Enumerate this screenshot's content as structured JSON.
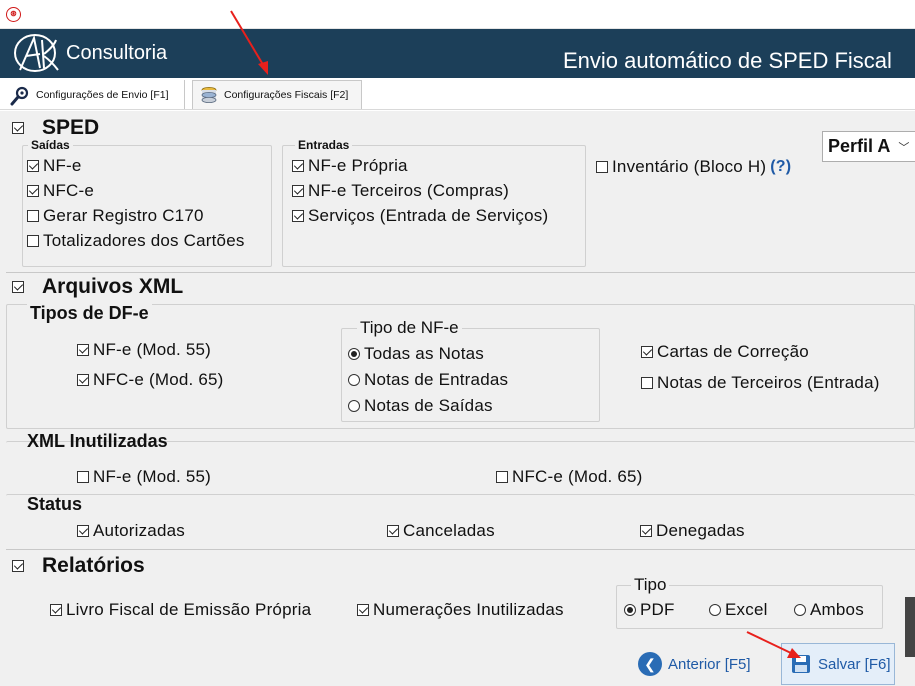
{
  "window": {
    "icon": "app-red-icon"
  },
  "banner": {
    "brand": "Consultoria",
    "title": "Envio automático de SPED Fiscal"
  },
  "tabs": [
    {
      "label": "Configurações de Envio [F1]",
      "icon": "wrench-gear-icon"
    },
    {
      "label": "Configurações Fiscais [F2]",
      "icon": "coins-icon"
    }
  ],
  "sped": {
    "heading": "SPED",
    "checked": true,
    "saidas": {
      "legend": "Saídas",
      "items": [
        {
          "label": "NF-e",
          "checked": true
        },
        {
          "label": "NFC-e",
          "checked": true
        },
        {
          "label": "Gerar Registro C170",
          "checked": false
        },
        {
          "label": "Totalizadores dos Cartões",
          "checked": false
        }
      ]
    },
    "entradas": {
      "legend": "Entradas",
      "items": [
        {
          "label": "NF-e Própria",
          "checked": true
        },
        {
          "label": "NF-e Terceiros (Compras)",
          "checked": true
        },
        {
          "label": "Serviços (Entrada de Serviços)",
          "checked": true
        }
      ]
    },
    "inventario": {
      "label": "Inventário (Bloco H)",
      "checked": false,
      "help": "(?)"
    },
    "perfil": {
      "value": "Perfil A"
    }
  },
  "xml": {
    "heading": "Arquivos XML",
    "checked": true,
    "tipos_df": {
      "heading": "Tipos de DF-e",
      "nfe": {
        "label": "NF-e (Mod. 55)",
        "checked": true
      },
      "nfce": {
        "label": "NFC-e (Mod. 65)",
        "checked": true
      }
    },
    "tipo_nfe": {
      "legend": "Tipo de NF-e",
      "options": [
        {
          "label": "Todas as Notas",
          "selected": true
        },
        {
          "label": "Notas de Entradas",
          "selected": false
        },
        {
          "label": "Notas de Saídas",
          "selected": false
        }
      ]
    },
    "cartas": {
      "label": "Cartas de Correção",
      "checked": true
    },
    "terceiros": {
      "label": "Notas de Terceiros (Entrada)",
      "checked": false
    },
    "inutilizadas": {
      "heading": "XML Inutilizadas",
      "nfe": {
        "label": "NF-e (Mod. 55)",
        "checked": false
      },
      "nfce": {
        "label": "NFC-e (Mod. 65)",
        "checked": false
      }
    },
    "status": {
      "heading": "Status",
      "autorizadas": {
        "label": "Autorizadas",
        "checked": true
      },
      "canceladas": {
        "label": "Canceladas",
        "checked": true
      },
      "denegadas": {
        "label": "Denegadas",
        "checked": true
      }
    }
  },
  "relatorios": {
    "heading": "Relatórios",
    "checked": true,
    "livro": {
      "label": "Livro Fiscal de Emissão Própria",
      "checked": true
    },
    "numeracoes": {
      "label": "Numerações Inutilizadas",
      "checked": true
    },
    "tipo": {
      "legend": "Tipo",
      "options": [
        {
          "label": "PDF",
          "selected": true
        },
        {
          "label": "Excel",
          "selected": false
        },
        {
          "label": "Ambos",
          "selected": false
        }
      ]
    }
  },
  "footer": {
    "prev_label": "Anterior [F5]",
    "save_label": "Salvar [F6]"
  },
  "colors": {
    "banner": "#1c3f59",
    "link": "#1f5aa6",
    "annotation_arrow": "#e8201c"
  }
}
